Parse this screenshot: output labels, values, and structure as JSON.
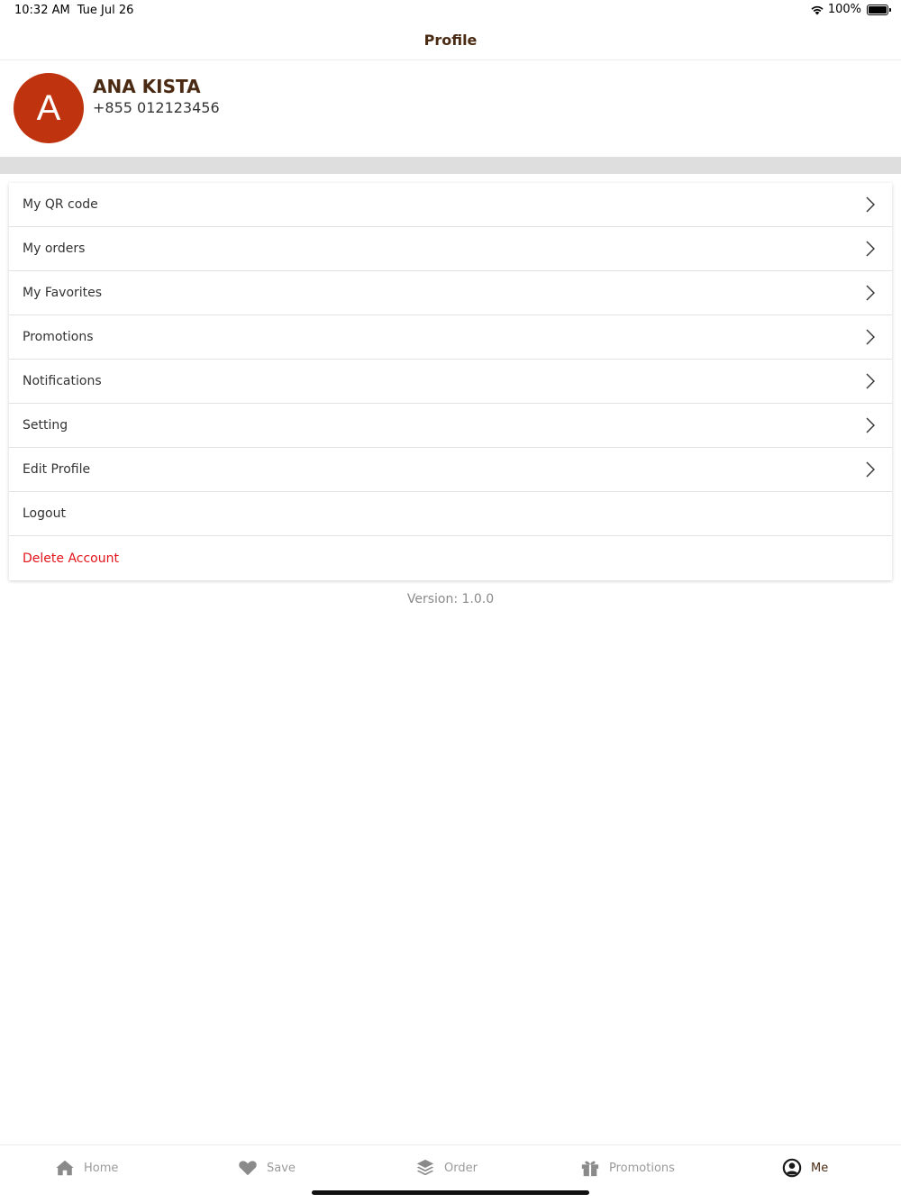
{
  "status_bar": {
    "time": "10:32 AM",
    "date": "Tue Jul 26",
    "battery": "100%"
  },
  "header": {
    "title": "Profile"
  },
  "profile": {
    "initial": "A",
    "name": "ANA KISTA",
    "phone": "+855 012123456",
    "avatar_color": "#c0330f"
  },
  "menu": {
    "items": [
      {
        "label": "My QR code"
      },
      {
        "label": "My orders"
      },
      {
        "label": "My Favorites"
      },
      {
        "label": "Promotions"
      },
      {
        "label": "Notifications"
      },
      {
        "label": "Setting"
      },
      {
        "label": "Edit Profile"
      },
      {
        "label": "Logout"
      },
      {
        "label": "Delete Account"
      }
    ]
  },
  "version": "Version: 1.0.0",
  "tabs": [
    {
      "label": "Home",
      "icon": "home-icon"
    },
    {
      "label": "Save",
      "icon": "heart-icon"
    },
    {
      "label": "Order",
      "icon": "layers-icon"
    },
    {
      "label": "Promotions",
      "icon": "gift-icon"
    },
    {
      "label": "Me",
      "icon": "user-circle-icon"
    }
  ],
  "colors": {
    "brand": "#4a2a12",
    "danger": "#e3141b",
    "inactive_tab": "#9a9a9a"
  }
}
